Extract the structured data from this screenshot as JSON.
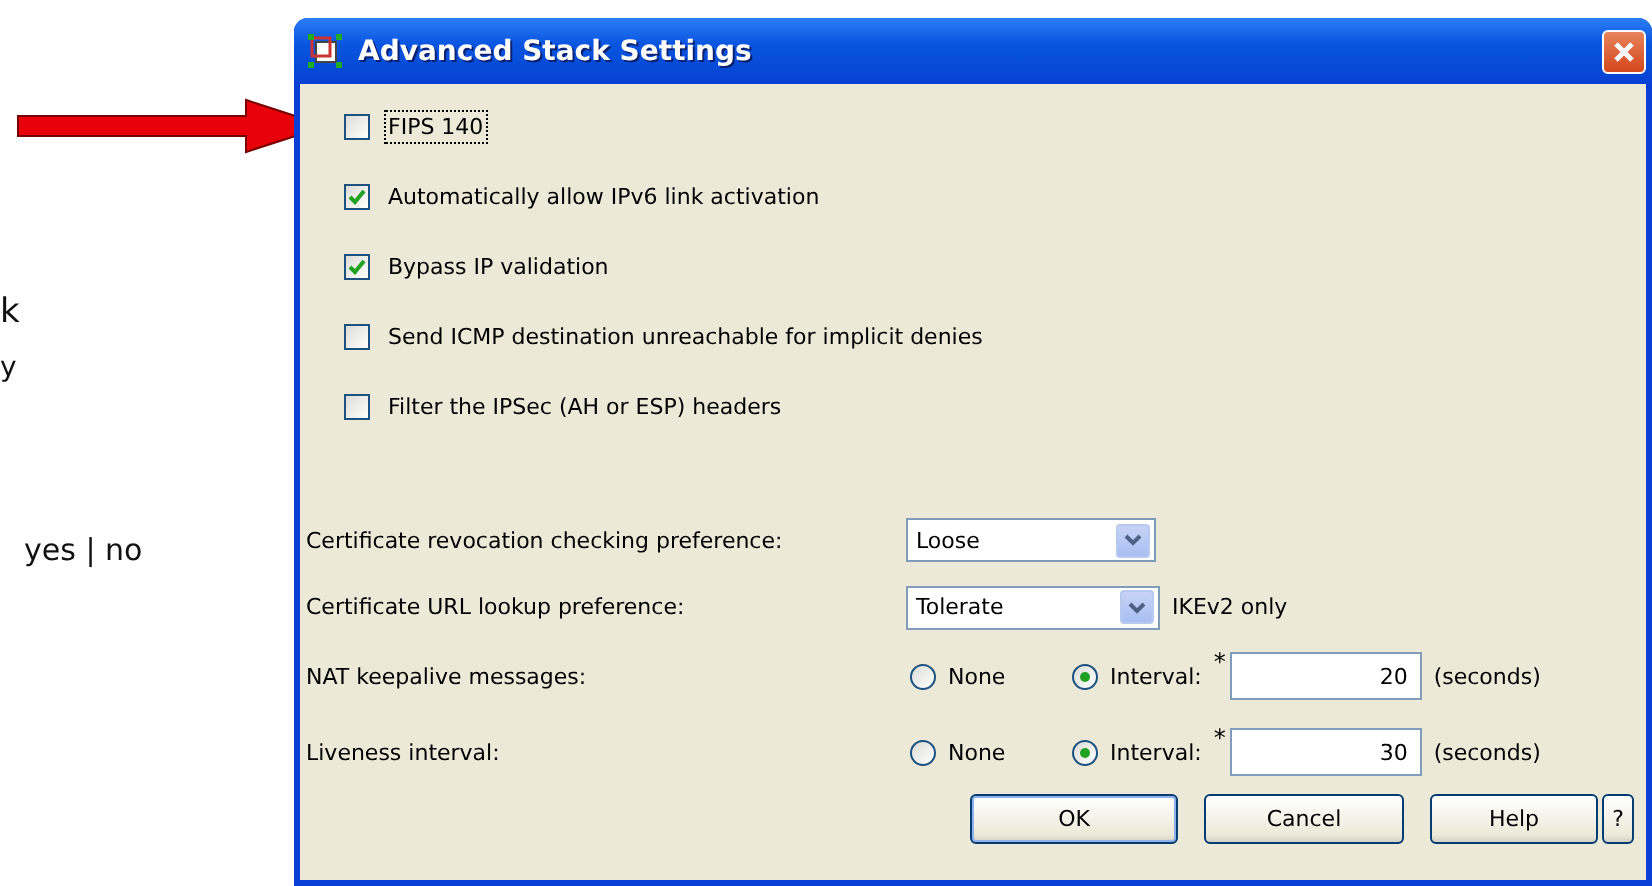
{
  "document": {
    "fragments": [
      "k",
      "y",
      "yes | no"
    ]
  },
  "dialog": {
    "title": "Advanced Stack Settings",
    "checkboxes": [
      {
        "label": "FIPS 140",
        "checked": false,
        "focused": true
      },
      {
        "label": "Automatically allow IPv6 link activation",
        "checked": true,
        "focused": false
      },
      {
        "label": "Bypass IP validation",
        "checked": true,
        "focused": false
      },
      {
        "label": "Send ICMP destination unreachable for implicit denies",
        "checked": false,
        "focused": false
      },
      {
        "label": "Filter the IPSec (AH or ESP) headers",
        "checked": false,
        "focused": false
      }
    ],
    "settings": [
      {
        "kind": "dropdown",
        "label": "Certificate revocation checking preference:",
        "value": "Loose"
      },
      {
        "kind": "dropdown",
        "label": "Certificate URL lookup preference:",
        "value": "Tolerate",
        "note": "IKEv2 only"
      },
      {
        "kind": "radio",
        "label": "NAT keepalive messages:",
        "options": [
          {
            "label": "None",
            "selected": false
          },
          {
            "label": "Interval:",
            "selected": true
          }
        ],
        "required": "*",
        "value": "20",
        "unit": "(seconds)"
      },
      {
        "kind": "radio",
        "label": "Liveness interval:",
        "options": [
          {
            "label": "None",
            "selected": false
          },
          {
            "label": "Interval:",
            "selected": true
          }
        ],
        "required": "*",
        "value": "30",
        "unit": "(seconds)"
      }
    ],
    "buttons": [
      "OK",
      "Cancel",
      "Help",
      "?"
    ]
  }
}
